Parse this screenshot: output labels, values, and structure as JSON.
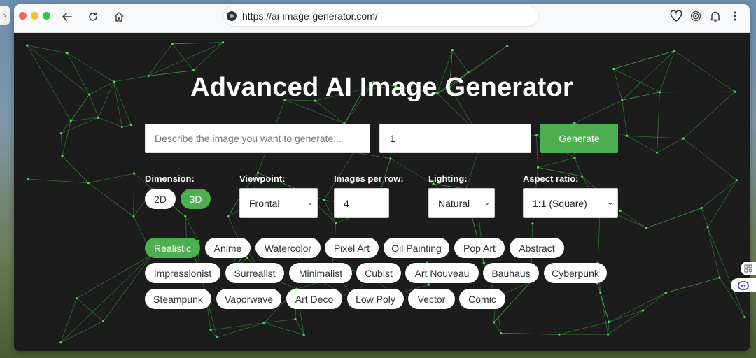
{
  "browser": {
    "url": "https://ai-image-generator.com/",
    "edge_tab_glyph": "›"
  },
  "page": {
    "title": "Advanced AI Image Generator",
    "prompt_placeholder": "Describe the image you want to generate...",
    "count_value": "1",
    "generate_label": "Generate",
    "accent_color": "#4caf50"
  },
  "options": {
    "dimension": {
      "label": "Dimension:",
      "choices": [
        "2D",
        "3D"
      ],
      "selected": "3D"
    },
    "viewpoint": {
      "label": "Viewpoint:",
      "value": "Frontal"
    },
    "images_per_row": {
      "label": "Images per row:",
      "value": "4"
    },
    "lighting": {
      "label": "Lighting:",
      "value": "Natural"
    },
    "aspect_ratio": {
      "label": "Aspect ratio:",
      "value": "1:1 (Square)"
    }
  },
  "styles": {
    "selected": "Realistic",
    "items": [
      "Realistic",
      "Anime",
      "Watercolor",
      "Pixel Art",
      "Oil Painting",
      "Pop Art",
      "Abstract",
      "Impressionist",
      "Surrealist",
      "Minimalist",
      "Cubist",
      "Art Nouveau",
      "Bauhaus",
      "Cyberpunk",
      "Steampunk",
      "Vaporwave",
      "Art Deco",
      "Low Poly",
      "Vector",
      "Comic"
    ]
  },
  "icons": [
    "back-arrow-icon",
    "reload-icon",
    "home-icon",
    "site-info-icon",
    "heart-icon",
    "spiral-icon",
    "bell-icon",
    "more-vert-icon",
    "extension-grid-icon",
    "robot-icon"
  ]
}
